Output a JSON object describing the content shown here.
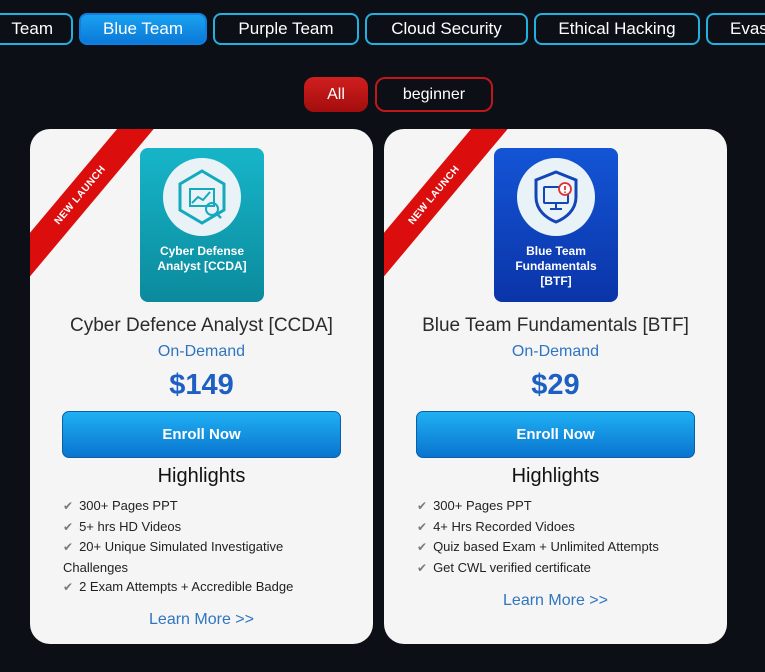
{
  "tabs": [
    {
      "label": "Team",
      "active": false
    },
    {
      "label": "Blue Team",
      "active": true
    },
    {
      "label": "Purple Team",
      "active": false
    },
    {
      "label": "Cloud Security",
      "active": false
    },
    {
      "label": "Ethical Hacking",
      "active": false
    },
    {
      "label": "Evas",
      "active": false
    }
  ],
  "filters": {
    "all": "All",
    "beginner": "beginner"
  },
  "colors": {
    "accent_blue": "#1aa2f0",
    "accent_red": "#d11f1f",
    "ribbon": "#dc0d0d",
    "background": "#0d0f17"
  },
  "cards": [
    {
      "ribbon": "NEW LAUNCH",
      "logo_text": "Cyber Defense Analyst [CCDA]",
      "logo_icon": "analytics-hexagon-icon",
      "title": "Cyber Defence Analyst [CCDA]",
      "delivery": "On-Demand",
      "price": "$149",
      "enroll": "Enroll Now",
      "highlights_heading": "Highlights",
      "highlights": [
        "300+ Pages PPT",
        "5+ hrs HD Videos",
        "20+ Unique Simulated Investigative Challenges",
        "2 Exam Attempts + Accredible Badge"
      ],
      "learn_more": "Learn More >>"
    },
    {
      "ribbon": "NEW LAUNCH",
      "logo_text": "Blue Team Fundamentals [BTF]",
      "logo_icon": "shield-monitor-icon",
      "title": "Blue Team Fundamentals [BTF]",
      "delivery": "On-Demand",
      "price": "$29",
      "enroll": "Enroll Now",
      "highlights_heading": "Highlights",
      "highlights": [
        "300+ Pages PPT",
        "4+ Hrs Recorded Vidoes",
        "Quiz based Exam + Unlimited Attempts",
        "Get CWL verified certificate"
      ],
      "learn_more": "Learn More >>"
    }
  ]
}
